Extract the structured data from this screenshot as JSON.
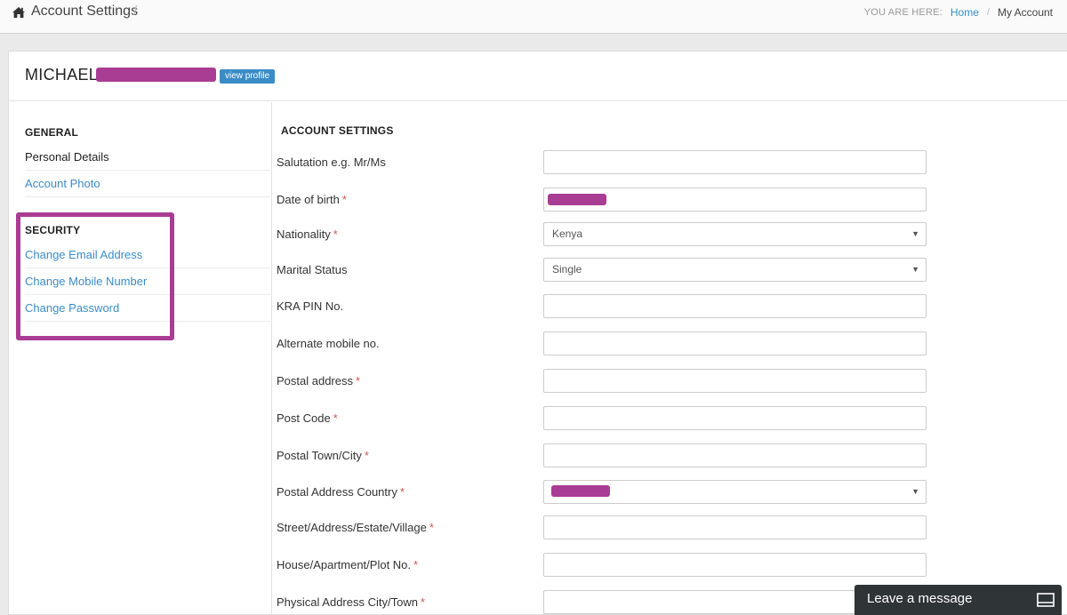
{
  "topbar": {
    "title": "Account Settings",
    "slash": "/",
    "breadcrumb": {
      "you_are_here": "YOU ARE HERE:",
      "home": "Home",
      "separator": "/",
      "current": "My Account"
    }
  },
  "profile": {
    "first_name": "MICHAEL",
    "view_profile_label": "view profile"
  },
  "sidebar": {
    "general_heading": "GENERAL",
    "general_items": [
      {
        "label": "Personal Details",
        "active": true
      },
      {
        "label": "Account Photo",
        "active": false
      }
    ],
    "security_heading": "SECURITY",
    "security_items": [
      {
        "label": "Change Email Address"
      },
      {
        "label": "Change Mobile Number"
      },
      {
        "label": "Change Password"
      }
    ]
  },
  "form": {
    "heading": "ACCOUNT SETTINGS",
    "required_marker": "*",
    "fields": [
      {
        "label": "Salutation e.g. Mr/Ms",
        "required": false,
        "type": "text",
        "value": ""
      },
      {
        "label": "Date of birth",
        "required": true,
        "type": "text",
        "value": ""
      },
      {
        "label": "Nationality",
        "required": true,
        "type": "select",
        "value": "Kenya"
      },
      {
        "label": "Marital Status",
        "required": false,
        "type": "select",
        "value": "Single"
      },
      {
        "label": "KRA PIN No.",
        "required": false,
        "type": "text",
        "value": ""
      },
      {
        "label": "Alternate mobile no.",
        "required": false,
        "type": "text",
        "value": ""
      },
      {
        "label": "Postal address",
        "required": true,
        "type": "text",
        "value": ""
      },
      {
        "label": "Post Code",
        "required": true,
        "type": "text",
        "value": ""
      },
      {
        "label": "Postal Town/City",
        "required": true,
        "type": "text",
        "value": ""
      },
      {
        "label": "Postal Address Country",
        "required": true,
        "type": "select",
        "value": ""
      },
      {
        "label": "Street/Address/Estate/Village",
        "required": true,
        "type": "text",
        "value": ""
      },
      {
        "label": "House/Apartment/Plot No.",
        "required": true,
        "type": "text",
        "value": ""
      },
      {
        "label": "Physical Address City/Town",
        "required": true,
        "type": "text",
        "value": ""
      }
    ]
  },
  "chat": {
    "label": "Leave a message"
  },
  "colors": {
    "link": "#3a8cc7",
    "redaction": "#a93c93",
    "required": "#d9534f",
    "chat_bg": "#2f3437"
  },
  "icons": [
    "home-icon",
    "chevron-down-icon",
    "chat-window-icon"
  ]
}
